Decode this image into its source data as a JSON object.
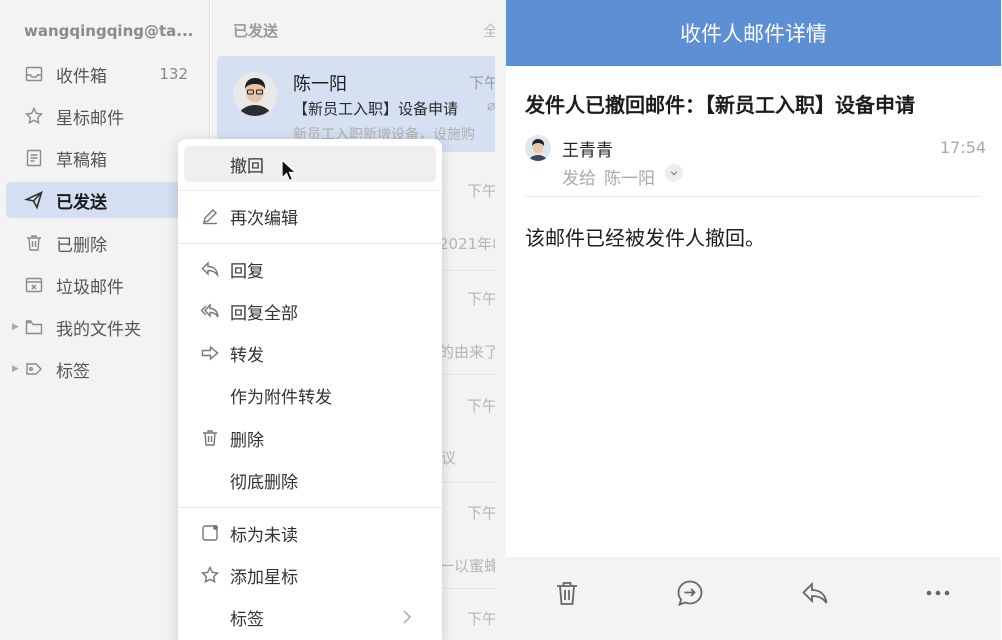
{
  "sidebar": {
    "account": "wangqingqing@ta...",
    "items": [
      {
        "label": "收件箱",
        "count": "132",
        "icon": "inbox-icon"
      },
      {
        "label": "星标邮件",
        "icon": "star-icon"
      },
      {
        "label": "草稿箱",
        "icon": "draft-icon"
      },
      {
        "label": "已发送",
        "icon": "send-icon",
        "active": true
      },
      {
        "label": "已删除",
        "icon": "trash-icon"
      },
      {
        "label": "垃圾邮件",
        "icon": "spam-icon"
      },
      {
        "label": "我的文件夹",
        "icon": "folder-icon"
      },
      {
        "label": "标签",
        "icon": "tag-icon"
      }
    ]
  },
  "list": {
    "title": "已发送",
    "title_right_fragment": "全",
    "selected": {
      "sender": "陈一阳",
      "time": "下午",
      "subject": "【新员工入职】设备申请",
      "preview": "新员工入职新增设备，设施购"
    },
    "peek": {
      "time": "下午",
      "date_fragment": "2021年8",
      "reason_fragment": "的由来了",
      "meeting_fragment": "议",
      "bees_fragment": "一以蜜蜂"
    }
  },
  "context_menu": {
    "items": [
      {
        "label": "撤回",
        "icon": ""
      },
      {
        "label": "再次编辑",
        "icon": "edit-icon"
      },
      {
        "label": "回复",
        "icon": "reply-icon"
      },
      {
        "label": "回复全部",
        "icon": "reply-all-icon"
      },
      {
        "label": "转发",
        "icon": "forward-icon"
      },
      {
        "label": "作为附件转发",
        "icon": ""
      },
      {
        "label": "删除",
        "icon": "trash-icon"
      },
      {
        "label": "彻底删除",
        "icon": ""
      },
      {
        "label": "标为未读",
        "icon": "unread-icon"
      },
      {
        "label": "添加星标",
        "icon": "star-icon"
      },
      {
        "label": "标签",
        "icon": "",
        "has_submenu": true
      }
    ]
  },
  "detail": {
    "header_title": "收件人邮件详情",
    "subject": "发件人已撤回邮件：【新员工入职】设备申请",
    "from": "王青青",
    "time": "17:54",
    "to_label": "发给",
    "to_name": "陈一阳",
    "body": "该邮件已经被发件人撤回。",
    "toolbar": [
      "delete-icon",
      "chat-forward-icon",
      "reply-icon",
      "more-icon"
    ]
  },
  "colors": {
    "header_blue": "#5c8fd3",
    "active_nav": "#d4e0f2",
    "selected_mail": "#d5e1f3"
  }
}
